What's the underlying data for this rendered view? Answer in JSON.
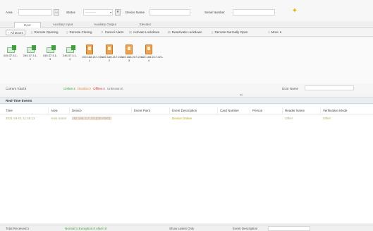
{
  "filters": {
    "area_label": "Area",
    "status_label": "Status",
    "status_value": "----------",
    "device_name_label": "Device Name",
    "serial_label": "Serial Number"
  },
  "tabs": [
    {
      "label": "Door"
    },
    {
      "label": "Auxiliary Input"
    },
    {
      "label": "Auxiliary Output"
    },
    {
      "label": "Elevator"
    }
  ],
  "toolbar": [
    {
      "label": "All Doors",
      "icon": "doors-icon"
    },
    {
      "label": "Remote Opening",
      "icon": "door-open-icon"
    },
    {
      "label": "Remote Closing",
      "icon": "door-close-icon"
    },
    {
      "label": "Cancel Alarm",
      "icon": "cancel-alarm-icon"
    },
    {
      "label": "Activate Lockdown",
      "icon": "lockdown-icon"
    },
    {
      "label": "Deactivate Lockdown",
      "icon": "unlock-icon"
    },
    {
      "label": "Remote Normally Open",
      "icon": "normally-open-icon"
    },
    {
      "label": "More",
      "icon": "more-icon"
    }
  ],
  "devices": [
    {
      "label": "245.37.3.1-1",
      "type": "green"
    },
    {
      "label": "245.37.3.1-2",
      "type": "green"
    },
    {
      "label": "245.37.3.1-3",
      "type": "green"
    },
    {
      "label": "245.37.3.1-4",
      "type": "green"
    },
    {
      "label": "192.168.217.221-1",
      "type": "orange"
    },
    {
      "label": "192.168.217.221-2",
      "type": "orange"
    },
    {
      "label": "192.168.217.221-3",
      "type": "orange"
    },
    {
      "label": "192.168.217.221-4",
      "type": "orange"
    }
  ],
  "status": {
    "current_total": "Current Total:8",
    "legend": [
      {
        "label": "Online:4",
        "cls": "green-t"
      },
      {
        "label": "Disable:0",
        "cls": "orange-t"
      },
      {
        "label": "Offline:4",
        "cls": "red-t"
      },
      {
        "label": "Unknown:0",
        "cls": "gray-t"
      }
    ],
    "door_name_label": "Door Name"
  },
  "panel": {
    "title": "Real-Time Events"
  },
  "grid": {
    "headers": [
      "Time",
      "Area",
      "Device",
      "Event Point",
      "Event Description",
      "Card Number",
      "Person",
      "Reader Name",
      "Verification Mode"
    ],
    "row": {
      "time": "2021-04-01 11:46:12",
      "area": "Area name",
      "device": "192.168.217.221(DEV0001)",
      "description": "Device Online",
      "reader": "Other",
      "verification": "Other"
    }
  },
  "footer": {
    "total": "Total Received:1",
    "legend": "Normal:1  Exception:0  Alarm:0",
    "show_latest": "Show Latest Only",
    "event_description": "Event Description"
  }
}
